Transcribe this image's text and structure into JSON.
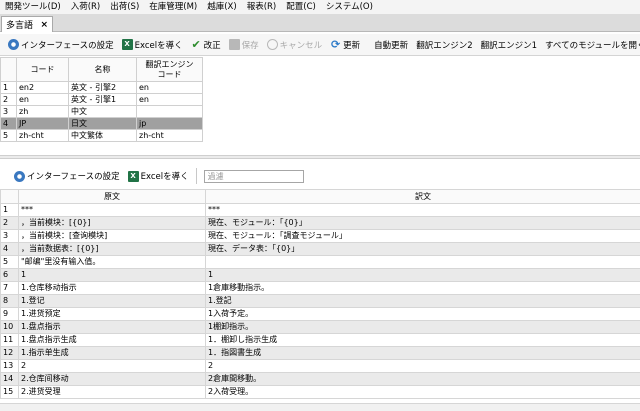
{
  "menubar": {
    "items": [
      "開発ツール(D)",
      "入荷(R)",
      "出荷(S)",
      "在庫管理(M)",
      "越庫(X)",
      "報表(R)",
      "配置(C)",
      "システム(O)"
    ]
  },
  "tab": {
    "label": "多言語",
    "close": "×"
  },
  "toolbar": {
    "interface_settings": "インターフェースの設定",
    "export_excel": "Excelを導く",
    "modify": "改正",
    "save": "保存",
    "cancel": "キャンセル",
    "refresh": "更新",
    "auto_refresh": "自動更新",
    "engine2": "翻訳エンジン2",
    "engine1": "翻訳エンジン1",
    "open_all": "すべてのモジュールを開く"
  },
  "languages_table": {
    "headers": [
      "コード",
      "名称",
      "翻訳エンジン\nコード"
    ],
    "rows": [
      {
        "num": "1",
        "code": "en2",
        "name": "英文 - 引擎2",
        "engine": "en"
      },
      {
        "num": "2",
        "code": "en",
        "name": "英文 - 引擎1",
        "engine": "en"
      },
      {
        "num": "3",
        "code": "zh",
        "name": "中文",
        "engine": ""
      },
      {
        "num": "4",
        "code": "JP",
        "name": "日文",
        "engine": "jp"
      },
      {
        "num": "5",
        "code": "zh-cht",
        "name": "中文繁体",
        "engine": "zh-cht"
      }
    ],
    "selected_row": 3
  },
  "toolbar2": {
    "interface_settings": "インターフェースの設定",
    "export_excel": "Excelを導く",
    "filter_placeholder": "過濾"
  },
  "translations_table": {
    "headers": [
      "原文",
      "訳文"
    ],
    "rows": [
      {
        "num": "1",
        "source": "***",
        "target": "***"
      },
      {
        "num": "2",
        "source": "，当前模块：[{0}]",
        "target": "現在、モジュール：「{0}」"
      },
      {
        "num": "3",
        "source": "，当前模块：[查询模块]",
        "target": "現在、モジュール：「調査モジュール」"
      },
      {
        "num": "4",
        "source": "，当前数据表：[{0}]",
        "target": "現在、データ表：「{0}」"
      },
      {
        "num": "5",
        "source": "\"邮编\"里没有输入值。",
        "target": ""
      },
      {
        "num": "6",
        "source": "1",
        "target": "1"
      },
      {
        "num": "7",
        "source": "1.仓库移动指示",
        "target": "1倉庫移動指示。"
      },
      {
        "num": "8",
        "source": "1.登记",
        "target": "1.登記"
      },
      {
        "num": "9",
        "source": "1.进货预定",
        "target": "1入荷予定。"
      },
      {
        "num": "10",
        "source": "1.盘点指示",
        "target": "1棚卸指示。"
      },
      {
        "num": "11",
        "source": "1.盘点指示生成",
        "target": "1．棚卸し指示生成"
      },
      {
        "num": "12",
        "source": "1.指示单生成",
        "target": "1．指図書生成"
      },
      {
        "num": "13",
        "source": "2",
        "target": "2"
      },
      {
        "num": "14",
        "source": "2.仓库间移动",
        "target": "2倉庫間移動。"
      },
      {
        "num": "15",
        "source": "2.进货受理",
        "target": "2入荷受理。"
      }
    ]
  }
}
